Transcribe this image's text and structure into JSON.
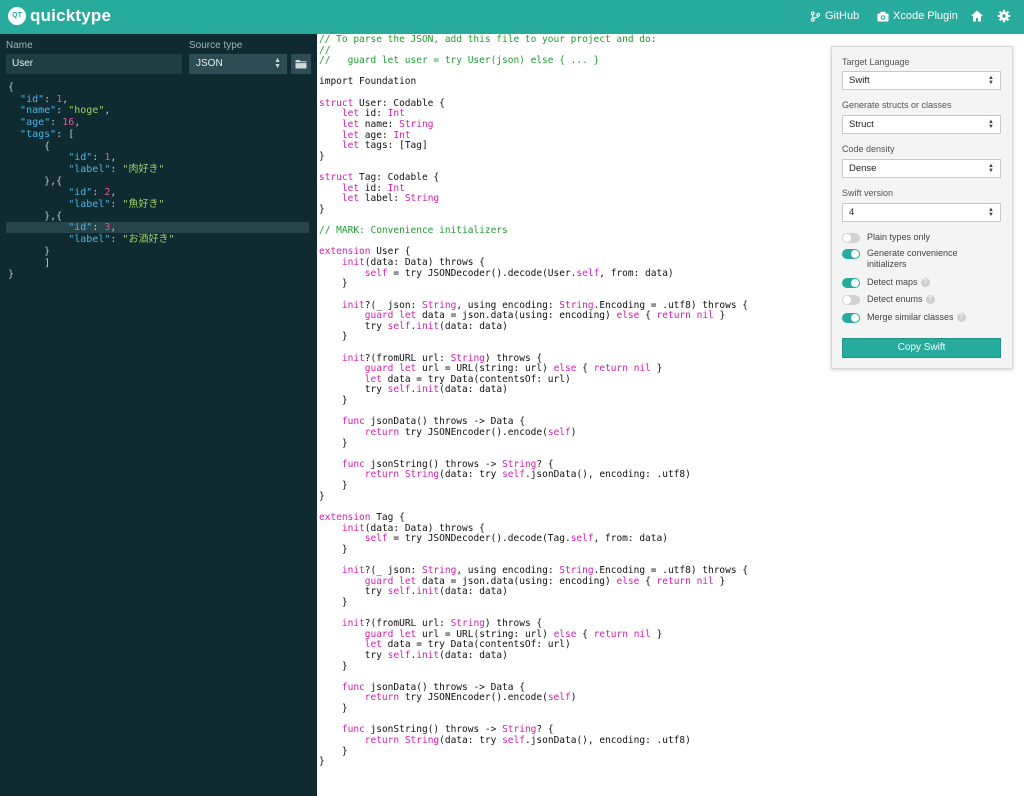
{
  "header": {
    "brand": "quicktype",
    "logo_text": "QT",
    "github_label": "GitHub",
    "xcode_label": "Xcode Plugin"
  },
  "left": {
    "name_label": "Name",
    "name_value": "User",
    "source_type_label": "Source type",
    "source_type_value": "JSON",
    "json_lines": [
      "{",
      "  \"id\": 1,",
      "  \"name\": \"hoge\",",
      "  \"age\": 16,",
      "  \"tags\": [",
      "      {",
      "          \"id\": 1,",
      "          \"label\": \"肉好き\"",
      "      },{",
      "          \"id\": 2,",
      "          \"label\": \"魚好き\"",
      "      },{",
      "          \"id\": 3,",
      "          \"label\": \"お酒好き\"",
      "      }",
      "      ]",
      "}"
    ]
  },
  "code": {
    "lines": [
      "// To parse the JSON, add this file to your project and do:",
      "//",
      "//   guard let user = try User(json) else { ... }",
      "",
      "import Foundation",
      "",
      "struct User: Codable {",
      "    let id: Int",
      "    let name: String",
      "    let age: Int",
      "    let tags: [Tag]",
      "}",
      "",
      "struct Tag: Codable {",
      "    let id: Int",
      "    let label: String",
      "}",
      "",
      "// MARK: Convenience initializers",
      "",
      "extension User {",
      "    init(data: Data) throws {",
      "        self = try JSONDecoder().decode(User.self, from: data)",
      "    }",
      "",
      "    init?(_ json: String, using encoding: String.Encoding = .utf8) throws {",
      "        guard let data = json.data(using: encoding) else { return nil }",
      "        try self.init(data: data)",
      "    }",
      "",
      "    init?(fromURL url: String) throws {",
      "        guard let url = URL(string: url) else { return nil }",
      "        let data = try Data(contentsOf: url)",
      "        try self.init(data: data)",
      "    }",
      "",
      "    func jsonData() throws -> Data {",
      "        return try JSONEncoder().encode(self)",
      "    }",
      "",
      "    func jsonString() throws -> String? {",
      "        return String(data: try self.jsonData(), encoding: .utf8)",
      "    }",
      "}",
      "",
      "extension Tag {",
      "    init(data: Data) throws {",
      "        self = try JSONDecoder().decode(Tag.self, from: data)",
      "    }",
      "",
      "    init?(_ json: String, using encoding: String.Encoding = .utf8) throws {",
      "        guard let data = json.data(using: encoding) else { return nil }",
      "        try self.init(data: data)",
      "    }",
      "",
      "    init?(fromURL url: String) throws {",
      "        guard let url = URL(string: url) else { return nil }",
      "        let data = try Data(contentsOf: url)",
      "        try self.init(data: data)",
      "    }",
      "",
      "    func jsonData() throws -> Data {",
      "        return try JSONEncoder().encode(self)",
      "    }",
      "",
      "    func jsonString() throws -> String? {",
      "        return String(data: try self.jsonData(), encoding: .utf8)",
      "    }",
      "}"
    ]
  },
  "options": {
    "target_language_label": "Target Language",
    "target_language_value": "Swift",
    "structs_label": "Generate structs or classes",
    "structs_value": "Struct",
    "density_label": "Code density",
    "density_value": "Dense",
    "swift_version_label": "Swift version",
    "swift_version_value": "4",
    "toggles": [
      {
        "label": "Plain types only",
        "on": false,
        "help": false
      },
      {
        "label": "Generate convenience initializers",
        "on": true,
        "help": false
      },
      {
        "label": "Detect maps",
        "on": true,
        "help": true
      },
      {
        "label": "Detect enums",
        "on": false,
        "help": true
      },
      {
        "label": "Merge similar classes",
        "on": true,
        "help": true
      }
    ],
    "copy_button": "Copy Swift"
  },
  "colors": {
    "accent": "#27ab9c",
    "left_bg": "#0f2a30",
    "keyword": "#d51cb1",
    "comment": "#1e9d2f"
  }
}
